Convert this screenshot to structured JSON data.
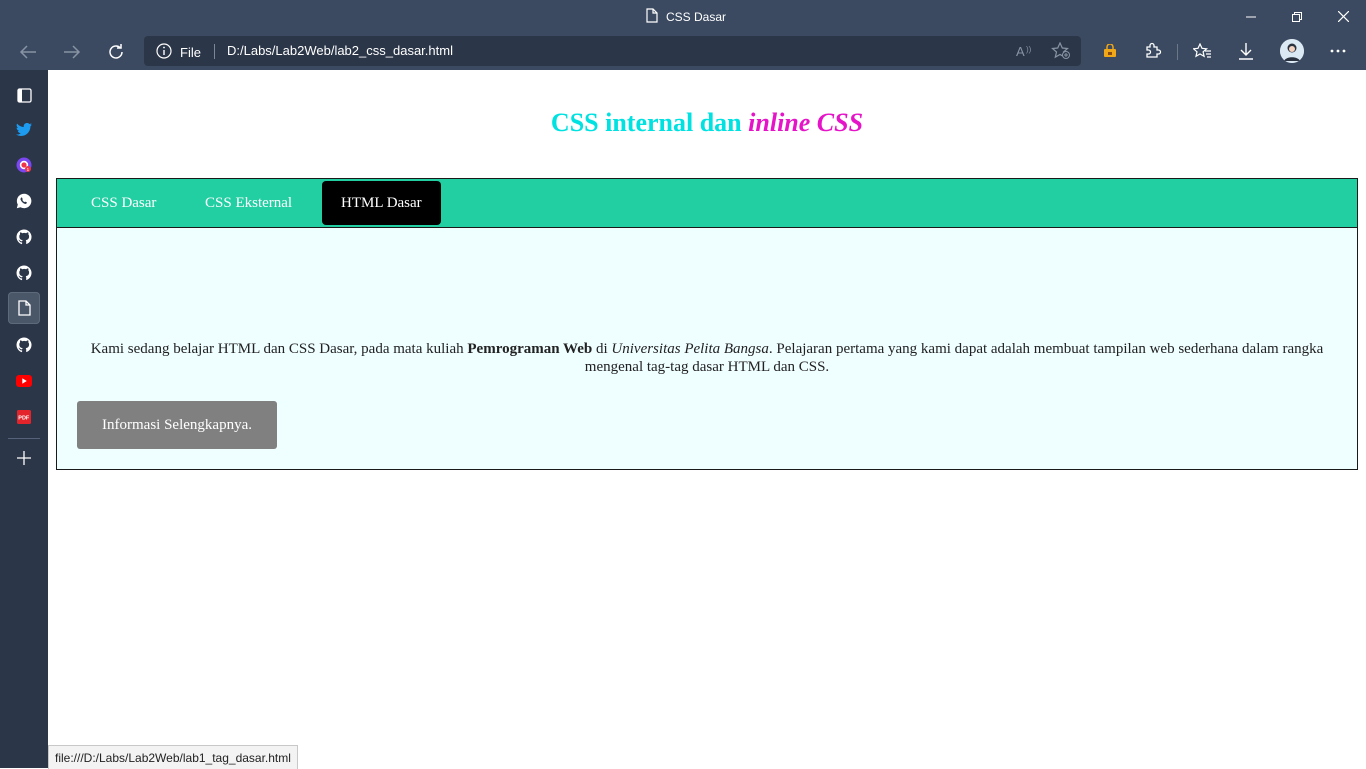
{
  "browser": {
    "tab_title": "CSS Dasar",
    "address": {
      "scheme_label": "File",
      "url": "D:/Labs/Lab2Web/lab2_css_dasar.html"
    },
    "status_url": "file:///D:/Labs/Lab2Web/lab1_tag_dasar.html",
    "accent": "#3b4a61"
  },
  "sidebar": {
    "items": [
      {
        "icon": "tab-actions-icon"
      },
      {
        "icon": "twitter-icon"
      },
      {
        "icon": "messenger-icon"
      },
      {
        "icon": "whatsapp-icon"
      },
      {
        "icon": "github-icon"
      },
      {
        "icon": "github-icon"
      },
      {
        "icon": "document-icon"
      },
      {
        "icon": "github-icon"
      },
      {
        "icon": "youtube-icon"
      },
      {
        "icon": "pdf-icon"
      },
      {
        "icon": "add-icon"
      }
    ]
  },
  "page": {
    "heading_plain": "CSS internal dan ",
    "heading_italic": "inline CSS",
    "nav": [
      {
        "label": "CSS Dasar",
        "active": false
      },
      {
        "label": "CSS Eksternal",
        "active": false
      },
      {
        "label": "HTML Dasar",
        "active": true
      }
    ],
    "content": {
      "text_before": "Kami sedang belajar HTML dan CSS Dasar, pada mata kuliah ",
      "bold": "Pemrograman Web",
      "text_mid": " di ",
      "italic": "Universitas Pelita Bangsa",
      "text_after": ". Pelajaran pertama yang kami dapat adalah membuat tampilan web sederhana dalam rangka mengenal tag-tag dasar HTML dan CSS."
    },
    "button_label": "Informasi Selengkapnya.",
    "colors": {
      "heading_cyan": "#00e1e1",
      "heading_magenta": "#e614c8",
      "navbar": "#22cfa2",
      "nav_active": "#000000",
      "content_bg": "#effeff",
      "button": "#808080"
    }
  }
}
